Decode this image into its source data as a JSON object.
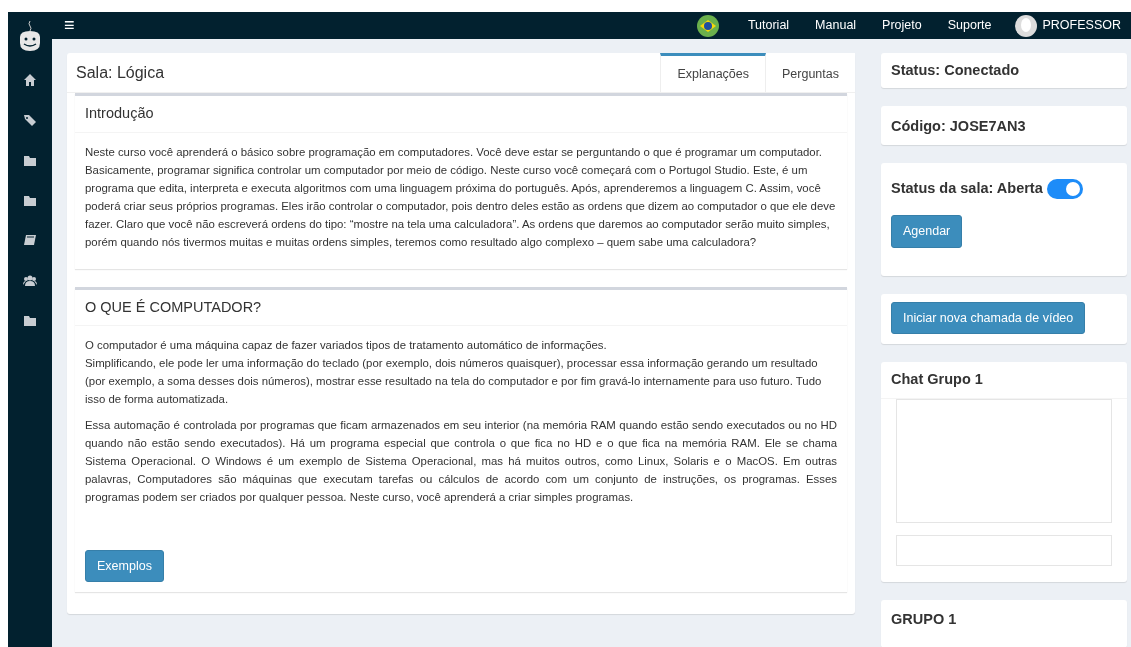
{
  "navbar": {
    "menu_glyph": "≡",
    "links": [
      "Tutorial",
      "Manual",
      "Projeto",
      "Suporte"
    ],
    "user": "PROFESSOR"
  },
  "sidebar": {
    "items": [
      {
        "kind": "home"
      },
      {
        "kind": "tags"
      },
      {
        "kind": "folder"
      },
      {
        "kind": "folder"
      },
      {
        "kind": "book"
      },
      {
        "kind": "users"
      },
      {
        "kind": "folder"
      }
    ]
  },
  "room": {
    "title": "Sala: Lógica",
    "tabs": [
      {
        "label": "Explanações",
        "selected": true
      },
      {
        "label": "Perguntas",
        "selected": false
      }
    ],
    "sections": [
      {
        "title": "Introdução",
        "paragraphs": [
          {
            "justify": false,
            "lines": [
              "Neste curso você aprenderá o básico sobre programação em computadores. Você deve estar se perguntando o que é programar um computador. Basicamente, programar significa controlar um computador por meio de código. Neste curso você começará com o Portugol Studio. Este, é um programa que edita, interpreta e executa algoritmos com uma linguagem próxima do português. Após, aprenderemos a linguagem C. Assim, você poderá criar seus próprios programas. Eles irão controlar o computador, pois dentro deles estão as ordens que dizem ao computador o que ele deve fazer. Claro que você não escreverá ordens do tipo: “mostre na tela uma calculadora”. As ordens que daremos ao computador serão muito simples, porém quando nós tivermos muitas e muitas ordens simples, teremos como resultado algo complexo – quem sabe uma calculadora?"
            ]
          }
        ]
      },
      {
        "title": "O QUE É COMPUTADOR?",
        "paragraphs": [
          {
            "justify": false,
            "lines": [
              "O computador é uma máquina capaz de fazer variados tipos de tratamento automático de informações.",
              "Simplificando, ele pode ler uma informação do teclado (por exemplo, dois números quaisquer), processar essa informação gerando um resultado (por exemplo, a soma desses dois números), mostrar esse resultado na tela do computador e por fim gravá-lo internamente para uso futuro. Tudo isso de forma automatizada."
            ]
          },
          {
            "justify": true,
            "lines": [
              "Essa automação é controlada por programas que ficam armazenados em seu interior (na memória RAM quando estão sendo executados ou no HD quando não estão sendo executados). Há um programa especial que controla o que fica no HD e o que fica na memória RAM. Ele se chama Sistema Operacional. O Windows é um exemplo de Sistema Operacional, mas há muitos outros, como Linux, Solaris e o MacOS. Em outras palavras, Computadores são máquinas que executam tarefas ou cálculos de acordo com um conjunto de instruções, os programas. Esses programas podem ser criados por qualquer pessoa. Neste curso, você aprenderá a criar simples programas."
            ]
          }
        ],
        "button": "Exemplos"
      }
    ]
  },
  "status": "Status: Conectado",
  "code": "Código: JOSE7AN3",
  "room_status": {
    "label": "Status da sala: Aberta",
    "on": true,
    "button": "Agendar"
  },
  "video_button": "Iniciar nova chamada de vídeo",
  "chat": {
    "title": "Chat Grupo 1"
  },
  "group": {
    "title": "GRUPO 1"
  }
}
